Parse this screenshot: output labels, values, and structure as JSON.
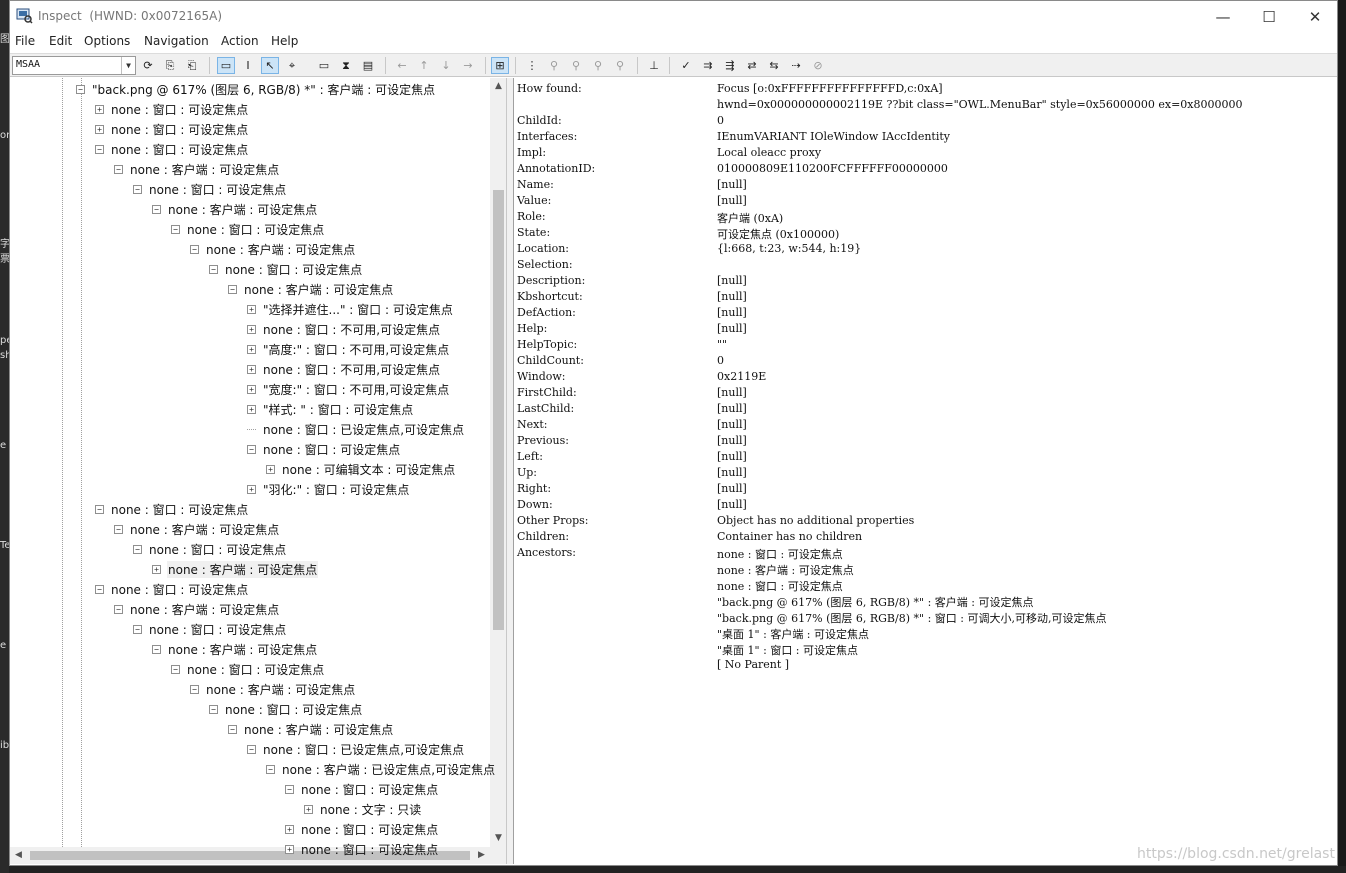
{
  "window": {
    "title": "Inspect",
    "hwnd": "(HWND: 0x0072165A)",
    "controls": {
      "minimize": "—",
      "maximize": "☐",
      "close": "✕"
    }
  },
  "menu": [
    "File",
    "Edit",
    "Options",
    "Navigation",
    "Action",
    "Help"
  ],
  "toolbar": {
    "mode_select": "MSAA",
    "icons": [
      "refresh-icon",
      "copy-icon",
      "paste-icon",
      "watch-focus-icon",
      "watch-caret-icon",
      "watch-cursor-icon",
      "watch-tracking-icon",
      "show-highlight-icon",
      "show-text-icon",
      "show-balloon-icon",
      "nav-back-icon",
      "nav-parent-icon",
      "nav-child-icon",
      "nav-forward-icon",
      "tree-view-icon",
      "nav-prev-sibling-icon",
      "nav-next-sibling-icon",
      "nav-first-child-icon",
      "nav-last-child-icon",
      "nav-up-icon",
      "nav-root-icon",
      "action-default-icon",
      "action-focus-icon",
      "action-select-icon",
      "action-add-select-icon",
      "action-remove-select-icon",
      "action-extend-icon",
      "action-clear-icon"
    ]
  },
  "tree": [
    {
      "label": "\"back.png @ 617% (图层 6, RGB/8) *\" : 客户端 : 可设定焦点",
      "indent": 0,
      "exp": "minus"
    },
    {
      "label": "none : 窗口 : 可设定焦点",
      "indent": 1,
      "exp": "plus"
    },
    {
      "label": "none : 窗口 : 可设定焦点",
      "indent": 1,
      "exp": "plus"
    },
    {
      "label": "none : 窗口 : 可设定焦点",
      "indent": 1,
      "exp": "minus"
    },
    {
      "label": "none : 客户端 : 可设定焦点",
      "indent": 2,
      "exp": "minus"
    },
    {
      "label": "none : 窗口 : 可设定焦点",
      "indent": 3,
      "exp": "minus"
    },
    {
      "label": "none : 客户端 : 可设定焦点",
      "indent": 4,
      "exp": "minus"
    },
    {
      "label": "none : 窗口 : 可设定焦点",
      "indent": 5,
      "exp": "minus"
    },
    {
      "label": "none : 客户端 : 可设定焦点",
      "indent": 6,
      "exp": "minus"
    },
    {
      "label": "none : 窗口 : 可设定焦点",
      "indent": 7,
      "exp": "minus"
    },
    {
      "label": "none : 客户端 : 可设定焦点",
      "indent": 8,
      "exp": "minus"
    },
    {
      "label": "\"选择并遮住...\" : 窗口 : 可设定焦点",
      "indent": 9,
      "exp": "plus"
    },
    {
      "label": "none : 窗口 : 不可用,可设定焦点",
      "indent": 9,
      "exp": "plus"
    },
    {
      "label": "\"高度:\" : 窗口 : 不可用,可设定焦点",
      "indent": 9,
      "exp": "plus"
    },
    {
      "label": "none : 窗口 : 不可用,可设定焦点",
      "indent": 9,
      "exp": "plus"
    },
    {
      "label": "\"宽度:\" : 窗口 : 不可用,可设定焦点",
      "indent": 9,
      "exp": "plus"
    },
    {
      "label": "\"样式:      \" : 窗口 : 可设定焦点",
      "indent": 9,
      "exp": "plus"
    },
    {
      "label": "none : 窗口 : 已设定焦点,可设定焦点",
      "indent": 9,
      "exp": "none"
    },
    {
      "label": "none : 窗口 : 可设定焦点",
      "indent": 9,
      "exp": "minus"
    },
    {
      "label": "none : 可编辑文本 : 可设定焦点",
      "indent": 10,
      "exp": "plus"
    },
    {
      "label": "\"羽化:\" : 窗口 : 可设定焦点",
      "indent": 9,
      "exp": "plus"
    },
    {
      "label": "none : 窗口 : 可设定焦点",
      "indent": 1,
      "exp": "minus"
    },
    {
      "label": "none : 客户端 : 可设定焦点",
      "indent": 2,
      "exp": "minus"
    },
    {
      "label": "none : 窗口 : 可设定焦点",
      "indent": 3,
      "exp": "minus"
    },
    {
      "label": "none : 客户端 : 可设定焦点",
      "indent": 4,
      "exp": "plus",
      "selected": true
    },
    {
      "label": "none : 窗口 : 可设定焦点",
      "indent": 1,
      "exp": "minus"
    },
    {
      "label": "none : 客户端 : 可设定焦点",
      "indent": 2,
      "exp": "minus"
    },
    {
      "label": "none : 窗口 : 可设定焦点",
      "indent": 3,
      "exp": "minus"
    },
    {
      "label": "none : 客户端 : 可设定焦点",
      "indent": 4,
      "exp": "minus"
    },
    {
      "label": "none : 窗口 : 可设定焦点",
      "indent": 5,
      "exp": "minus"
    },
    {
      "label": "none : 客户端 : 可设定焦点",
      "indent": 6,
      "exp": "minus"
    },
    {
      "label": "none : 窗口 : 可设定焦点",
      "indent": 7,
      "exp": "minus"
    },
    {
      "label": "none : 客户端 : 可设定焦点",
      "indent": 8,
      "exp": "minus"
    },
    {
      "label": "none : 窗口 : 已设定焦点,可设定焦点",
      "indent": 9,
      "exp": "minus"
    },
    {
      "label": "none : 客户端 : 已设定焦点,可设定焦点",
      "indent": 10,
      "exp": "minus"
    },
    {
      "label": "none : 窗口 : 可设定焦点",
      "indent": 11,
      "exp": "minus"
    },
    {
      "label": "none : 文字 : 只读",
      "indent": 12,
      "exp": "plus"
    },
    {
      "label": "none : 窗口 : 可设定焦点",
      "indent": 11,
      "exp": "plus"
    },
    {
      "label": "none : 窗口 : 可设定焦点",
      "indent": 11,
      "exp": "plus"
    }
  ],
  "properties": [
    [
      "How found:",
      "Focus [o:0xFFFFFFFFFFFFFFFD,c:0xA]"
    ],
    [
      "",
      "hwnd=0x000000000002119E ??bit class=\"OWL.MenuBar\" style=0x56000000 ex=0x8000000"
    ],
    [
      "ChildId:",
      "0"
    ],
    [
      "Interfaces:",
      "IEnumVARIANT IOleWindow IAccIdentity"
    ],
    [
      "Impl:",
      "Local oleacc proxy"
    ],
    [
      "AnnotationID:",
      "010000809E110200FCFFFFFF00000000"
    ],
    [
      "Name:",
      "[null]"
    ],
    [
      "Value:",
      "[null]"
    ],
    [
      "Role:",
      "客户端 (0xA)"
    ],
    [
      "State:",
      "可设定焦点 (0x100000)"
    ],
    [
      "Location:",
      "{l:668, t:23, w:544, h:19}"
    ],
    [
      "Selection:",
      ""
    ],
    [
      "Description:",
      "[null]"
    ],
    [
      "Kbshortcut:",
      "[null]"
    ],
    [
      "DefAction:",
      "[null]"
    ],
    [
      "Help:",
      "[null]"
    ],
    [
      "HelpTopic:",
      "\"\""
    ],
    [
      "ChildCount:",
      "0"
    ],
    [
      "Window:",
      "0x2119E"
    ],
    [
      "FirstChild:",
      "[null]"
    ],
    [
      "LastChild:",
      "[null]"
    ],
    [
      "Next:",
      "[null]"
    ],
    [
      "Previous:",
      "[null]"
    ],
    [
      "Left:",
      "[null]"
    ],
    [
      "Up:",
      "[null]"
    ],
    [
      "Right:",
      "[null]"
    ],
    [
      "Down:",
      "[null]"
    ],
    [
      "Other Props:",
      "Object has no additional properties"
    ],
    [
      "Children:",
      "Container has no children"
    ],
    [
      "Ancestors:",
      "none : 窗口 : 可设定焦点"
    ],
    [
      "",
      "none : 客户端 : 可设定焦点"
    ],
    [
      "",
      "none : 窗口 : 可设定焦点"
    ],
    [
      "",
      "\"back.png @ 617% (图层 6, RGB/8) *\" : 客户端 : 可设定焦点"
    ],
    [
      "",
      "\"back.png @ 617% (图层 6, RGB/8) *\" : 窗口 : 可调大小,可移动,可设定焦点"
    ],
    [
      "",
      "\"桌面 1\" : 客户端 : 可设定焦点"
    ],
    [
      "",
      "\"桌面 1\" : 窗口 : 可设定焦点"
    ],
    [
      "",
      "[ No Parent ]"
    ]
  ],
  "watermark": "https://blog.csdn.net/grelast",
  "background_fragments": [
    "图",
    "or",
    "字",
    "票",
    "pe",
    "sh",
    "e",
    "Te",
    "e",
    "ib"
  ]
}
